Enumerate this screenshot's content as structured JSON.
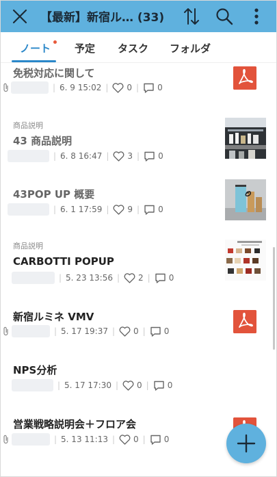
{
  "header": {
    "title": "【最新】新宿ル… (33)"
  },
  "tabs": [
    {
      "label": "ノート"
    },
    {
      "label": "予定"
    },
    {
      "label": "タスク"
    },
    {
      "label": "フォルダ"
    }
  ],
  "colors": {
    "header_bg": "#5fb1de",
    "accent": "#2a87c9",
    "pdf_red": "#e2533b",
    "badge_dot": "#e85a3c"
  },
  "notes": [
    {
      "category": "",
      "title": "免税対応に関して",
      "date": "6. 9 15:02",
      "likes": "0",
      "comments": "0",
      "thumbnail": "pdf-icon"
    },
    {
      "category": "商品説明",
      "title": "43 商品説明",
      "date": "6. 8 16:47",
      "likes": "3",
      "comments": "0",
      "thumbnail": "photo-store-shelf"
    },
    {
      "category": "",
      "title": "43POP UP 概要",
      "date": "6. 1 17:59",
      "likes": "9",
      "comments": "0",
      "thumbnail": "photo-gift-box"
    },
    {
      "category": "商品説明",
      "title": "CARBOTTI POPUP",
      "date": "5. 23 13:56",
      "likes": "2",
      "comments": "0",
      "thumbnail": "photo-bag-catalog"
    },
    {
      "category": "",
      "title": "新宿ルミネ VMV",
      "date": "5. 17 19:37",
      "likes": "0",
      "comments": "0",
      "thumbnail": "pdf-icon"
    },
    {
      "category": "",
      "title": "NPS分析",
      "date": "5. 17 17:30",
      "likes": "0",
      "comments": "0",
      "thumbnail": ""
    },
    {
      "category": "",
      "title": "営業戦略説明会＋フロア会",
      "date": "5. 13 11:13",
      "likes": "0",
      "comments": "0",
      "thumbnail": "pdf-icon"
    }
  ]
}
